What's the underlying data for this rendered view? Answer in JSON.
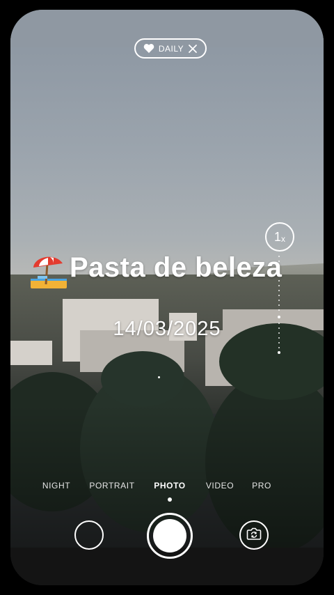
{
  "daily_pill": {
    "label": "DAILY"
  },
  "zoom": {
    "value": "1",
    "unit": "x"
  },
  "overlay": {
    "title": "Pasta de beleza",
    "date": "14/03/2025"
  },
  "modes": [
    {
      "label": "NIGHT",
      "active": false
    },
    {
      "label": "PORTRAIT",
      "active": false
    },
    {
      "label": "PHOTO",
      "active": true
    },
    {
      "label": "VIDEO",
      "active": false
    },
    {
      "label": "PRO",
      "active": false
    }
  ],
  "icons": {
    "heart": "heart-icon",
    "close": "close-icon",
    "emoji": "beach-umbrella-emoji",
    "switch_camera": "switch-camera-icon"
  },
  "colors": {
    "accent": "#ffffff",
    "background": "#000000"
  }
}
